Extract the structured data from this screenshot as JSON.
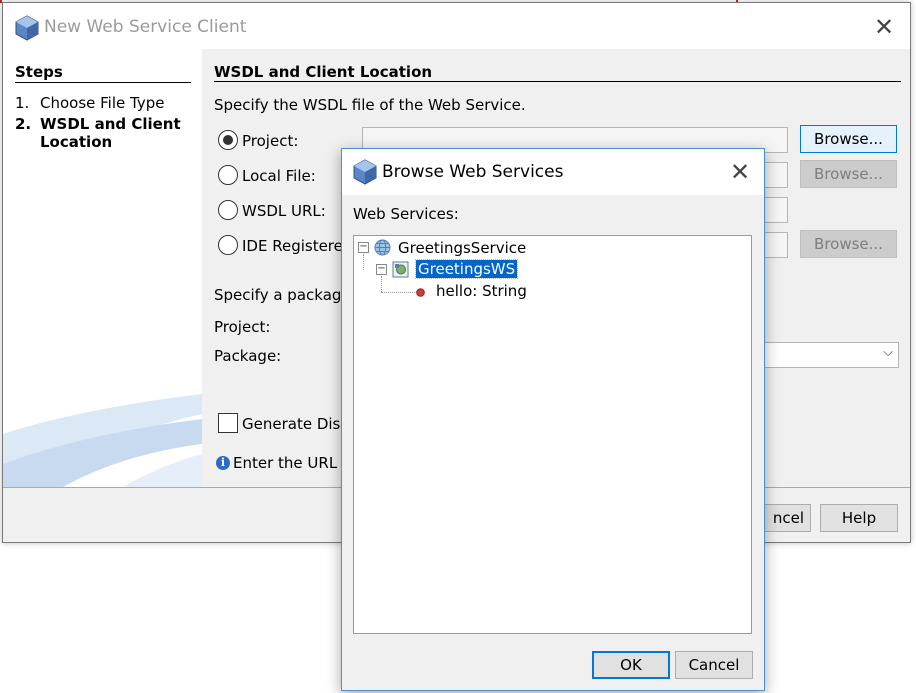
{
  "main_dialog": {
    "title": "New Web Service Client",
    "steps": {
      "title": "Steps",
      "items": [
        {
          "num": "1.",
          "label": "Choose File Type"
        },
        {
          "num": "2.",
          "label": "WSDL and Client",
          "label2": "Location"
        }
      ]
    },
    "content": {
      "title": "WSDL and Client Location",
      "instruction": "Specify the WSDL file of the Web Service.",
      "options": {
        "project": "Project:",
        "local_file": "Local File:",
        "wsdl_url": "WSDL URL:",
        "ide_registered": "IDE Registered"
      },
      "browse_label": "Browse...",
      "package_prompt": "Specify a package",
      "project_label": "Project:",
      "package_label": "Package:",
      "generate_label": "Generate Disp",
      "info_text": "Enter the URL o"
    },
    "footer": {
      "cancel_label": "ncel",
      "help_label": "Help"
    }
  },
  "browse_dialog": {
    "title": "Browse Web Services",
    "list_label": "Web Services:",
    "tree": {
      "root": "GreetingsService",
      "child": "GreetingsWS",
      "operation": "hello: String"
    },
    "ok_label": "OK",
    "cancel_label": "Cancel"
  },
  "colors": {
    "accent": "#0078d7",
    "selection": "#0066cc",
    "dialog_bg": "#f0f0f0"
  }
}
